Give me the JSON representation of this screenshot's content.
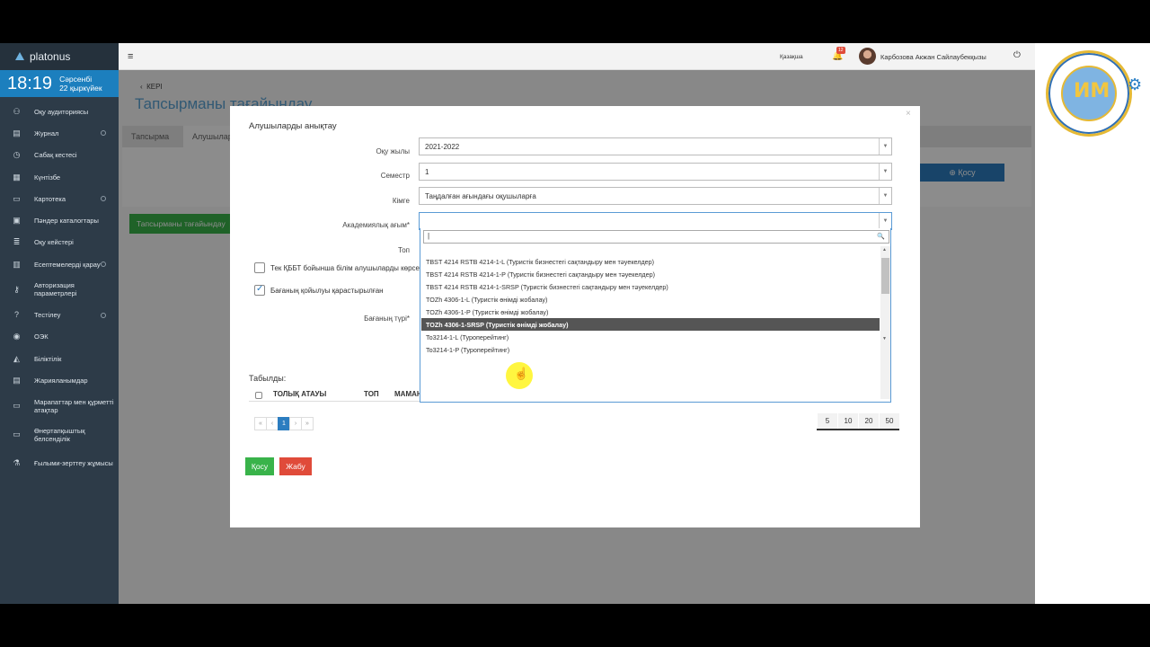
{
  "brand": "platonus",
  "clock": {
    "time": "18:19",
    "weekday": "Сәрсенбі",
    "date": "22 қыркүйек"
  },
  "sidebar": {
    "items": [
      {
        "label": "Оқу аудиториясы",
        "icon": "users-icon",
        "glyph": "⚇"
      },
      {
        "label": "Журнал",
        "icon": "journal-icon",
        "glyph": "▤"
      },
      {
        "label": "Сабақ кестесі",
        "icon": "clock-icon",
        "glyph": "◷"
      },
      {
        "label": "Күнтізбе",
        "icon": "calendar-icon",
        "glyph": "▦"
      },
      {
        "label": "Картотека",
        "icon": "folder-icon",
        "glyph": "▭"
      },
      {
        "label": "Пәндер каталогтары",
        "icon": "catalog-icon",
        "glyph": "▣"
      },
      {
        "label": "Оқу кейстері",
        "icon": "list-icon",
        "glyph": "≣"
      },
      {
        "label": "Есептемелерді қарау",
        "icon": "reports-icon",
        "glyph": "▥"
      },
      {
        "label": "Авторизация параметрлері",
        "icon": "key-icon",
        "glyph": "⚷"
      },
      {
        "label": "Тестілеу",
        "icon": "question-icon",
        "glyph": "?"
      },
      {
        "label": "ОЭК",
        "icon": "disc-icon",
        "glyph": "◉"
      },
      {
        "label": "Біліктілік",
        "icon": "graduation-icon",
        "glyph": "◭"
      },
      {
        "label": "Жарияланымдар",
        "icon": "publications-icon",
        "glyph": "▤"
      },
      {
        "label": "Марапаттар мен құрметті атақтар",
        "icon": "award-icon",
        "glyph": "▭"
      },
      {
        "label": "Өнертапқыштық белсенділік",
        "icon": "invention-icon",
        "glyph": "▭"
      },
      {
        "label": "Ғылыми-зерттеу жұмысы",
        "icon": "flask-icon",
        "glyph": "⚗"
      }
    ]
  },
  "topbar": {
    "menu_glyph": "≡",
    "language": "Қазақша",
    "notifications_count": "12",
    "user_name": "Карбозова Акжан Сайлаубекқызы"
  },
  "page": {
    "back_label": "КЕРІ",
    "title": "Тапсырманы тағайындау",
    "tabs": [
      "Тапсырма",
      "Алушылар"
    ],
    "add_button": "Қосу",
    "assign_button": "Тапсырманы тағайындау"
  },
  "modal": {
    "title": "Алушыларды анықтау",
    "close_glyph": "×",
    "fields": {
      "year_label": "Оқу жылы",
      "year_value": "2021-2022",
      "semester_label": "Семестр",
      "semester_value": "1",
      "to_label": "Кімге",
      "to_value": "Таңдалған ағындағы оқушыларға",
      "stream_label": "Академиялық ағым*",
      "group_label": "Топ",
      "column_type_label": "Бағаның түрі*"
    },
    "checkbox_only_label": "Тек ҚББТ бойынша білім алушыларды көрсету",
    "checkbox_grading_label": "Бағаның қойылуы қарастырылған",
    "found_label": "Табылды:",
    "table_headers": [
      "ТОЛЫҚ АТАУЫ",
      "ТОП",
      "МАМАН"
    ],
    "pager": [
      "«",
      "‹",
      "1",
      "›",
      "»"
    ],
    "page_sizes": [
      "5",
      "10",
      "20",
      "50"
    ],
    "add_button": "Қосу",
    "close_button": "Жабу"
  },
  "dropdown": {
    "search_value": "",
    "options": [
      "TBST 4214 RSTB 4214-1-L (Туристік бизнестегі сақтандыру мен тәуекелдер)",
      "TBST 4214 RSTB 4214-1-P (Туристік бизнестегі сақтандыру мен тәуекелдер)",
      "TBST 4214 RSTB 4214-1-SRSP (Туристік бизнестегі сақтандыру мен тәуекелдер)",
      "TOZh 4306-1-L (Туристік өнімді жобалау)",
      "TOZh 4306-1-P (Туристік өнімді жобалау)",
      "TOZh 4306-1-SRSP (Туристік өнімді жобалау)",
      "To3214-1-L (Туроперейтинг)",
      "To3214-1-P (Туроперейтинг)"
    ],
    "selected_index": 5
  },
  "colors": {
    "sidebar_bg": "#2d3b48",
    "clock_bg": "#1c7fbe",
    "primary": "#2c7dc0",
    "success": "#39b34a",
    "danger": "#e04b3a"
  }
}
